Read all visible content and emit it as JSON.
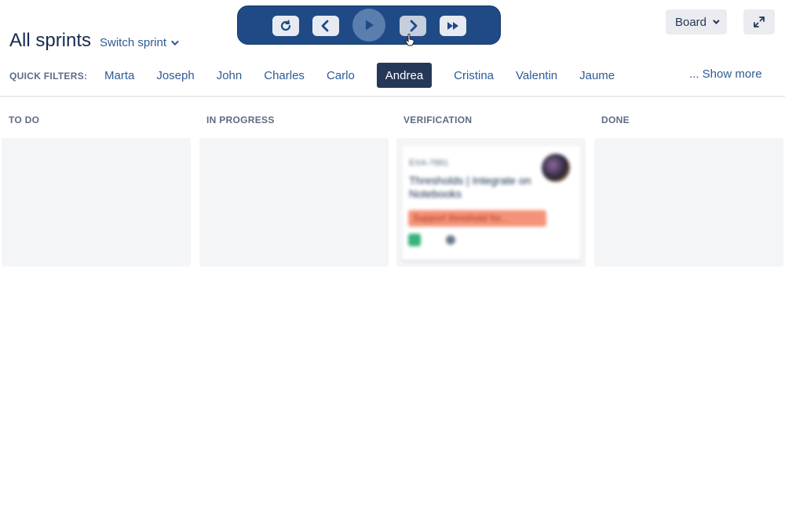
{
  "header": {
    "title": "All sprints",
    "switch_sprint": "Switch sprint",
    "board_label": "Board"
  },
  "player": {
    "controls": [
      "replay-icon",
      "previous-icon",
      "play-icon",
      "next-icon",
      "fast-forward-icon"
    ]
  },
  "quick_filters": {
    "label": "QUICK FILTERS:",
    "items": [
      {
        "label": "Marta",
        "active": false
      },
      {
        "label": "Joseph",
        "active": false
      },
      {
        "label": "John",
        "active": false
      },
      {
        "label": "Charles",
        "active": false
      },
      {
        "label": "Carlo",
        "active": false
      },
      {
        "label": "Andrea",
        "active": true
      },
      {
        "label": "Cristina",
        "active": false
      },
      {
        "label": "Valentin",
        "active": false
      },
      {
        "label": "Jaume",
        "active": false
      }
    ],
    "show_more": "... Show more"
  },
  "columns": [
    {
      "name": "TO DO"
    },
    {
      "name": "IN PROGRESS"
    },
    {
      "name": "VERIFICATION"
    },
    {
      "name": "DONE"
    }
  ],
  "card": {
    "key": "EXA-7881",
    "summary": "Thresholds | Integrate on Notebooks",
    "epic": "Support threshold for...",
    "colors": {
      "epic_bg": "#f5937a",
      "story": "#36b37e"
    }
  },
  "colors": {
    "accent": "#253858",
    "link": "#2e5b94",
    "player_bg": "#1f4a86"
  }
}
